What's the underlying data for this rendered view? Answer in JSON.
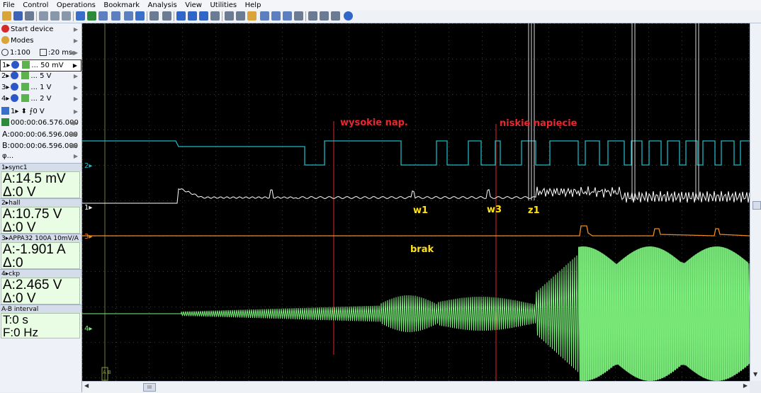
{
  "menu": [
    "File",
    "Control",
    "Operations",
    "Bookmark",
    "Analysis",
    "View",
    "Utilities",
    "Help"
  ],
  "left": {
    "start_device": "Start device",
    "modes": "Modes",
    "zoom": "1:100",
    "timebase": ":20 ms",
    "channels": [
      {
        "num": "1",
        "scale": "... 50 mV",
        "color": "#ffffff"
      },
      {
        "num": "2",
        "scale": "... 5 V",
        "color": "#2ec2c9"
      },
      {
        "num": "3",
        "scale": "... 1 V",
        "color": "#f08a24"
      },
      {
        "num": "4",
        "scale": "... 2 V",
        "color": "#4ad34a"
      }
    ],
    "trigger": "1",
    "trigger_level": "0 V",
    "t_pos": "000:00:06.576.000",
    "a_pos": "000:00:06.596.000",
    "b_pos": "000:00:06.596.000",
    "a_label": "A:",
    "b_label": "B:",
    "phi": "φ..."
  },
  "readouts": [
    {
      "header": "1▸sync1",
      "a": "A:14.5 mV",
      "d": "Δ:0 V"
    },
    {
      "header": "2▸hall",
      "a": "A:10.75 V",
      "d": "Δ:0 V"
    },
    {
      "header": "3▸APPA32 100A 10mV/A",
      "a": "A:-1.901 A",
      "d": "Δ:0"
    },
    {
      "header": "4▸ckp",
      "a": "A:2.465 V",
      "d": "Δ:0 V"
    },
    {
      "header": "A-B interval",
      "a": "T:0 s",
      "d": "F:0 Hz"
    }
  ],
  "scope": {
    "markers": [
      "2▸",
      "1▸",
      "3▸",
      "4▸"
    ],
    "annotations": {
      "wysokie": "wysokie nap.",
      "niskie": "niskie napięcie",
      "w1": "w1",
      "w3": "w3",
      "z1": "z1",
      "brak": "brak"
    },
    "cursor_label": "A B",
    "colors": {
      "ch1": "#ffffff",
      "ch2": "#1fb7c4",
      "ch3": "#f08a24",
      "ch4": "#7df27d",
      "annot_red": "#e8282f",
      "annot_yellow": "#ffe21a",
      "cursor_line": "#b8211c"
    }
  },
  "hscroll_thumb": "III"
}
